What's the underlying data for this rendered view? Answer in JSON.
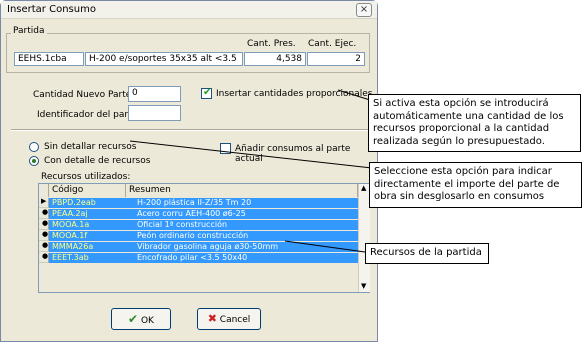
{
  "window": {
    "title": "Insertar Consumo",
    "close_glyph": "×"
  },
  "partida": {
    "group_label": "Partida",
    "col_pres": "Cant. Pres.",
    "col_ejec": "Cant. Ejec.",
    "code": "EEHS.1cba",
    "description": "H-200 e/soportes 35x35 alt <3.5",
    "cant_pres": "4,538",
    "cant_ejec": "2"
  },
  "form": {
    "cantidad_label": "Cantidad Nuevo Parte:",
    "cantidad_value": "0",
    "identificador_label": "Identificador del parte:",
    "identificador_value": "",
    "proporcionales_label": "Insertar cantidades proporcionales",
    "proporcionales_checked": true
  },
  "options": {
    "sin_detallar": "Sin detallar recursos",
    "con_detalle": "Con detalle de recursos",
    "selected": "con_detalle",
    "anadir_label": "Añadir consumos al parte actual",
    "anadir_checked": false
  },
  "recursos": {
    "label": "Recursos utilizados:",
    "col_codigo": "Código",
    "col_resumen": "Resumen",
    "rows": [
      {
        "code": "PBPD.2eab",
        "resumen": "H-200 plástica II-Z/35 Tm 20"
      },
      {
        "code": "PEAA.2aj",
        "resumen": "Acero corru AEH-400 ø6-25"
      },
      {
        "code": "MOOA.1a",
        "resumen": "Oficial 1ª construcción"
      },
      {
        "code": "MOOA.1f",
        "resumen": "Peón ordinario construcción"
      },
      {
        "code": "MMMA26a",
        "resumen": "Vibrador gasolina aguja ø30-50mm"
      },
      {
        "code": "EEET.3ab",
        "resumen": "Encofrado pilar <3.5 50x40"
      }
    ],
    "scroll_up": "▲",
    "scroll_down": "▼"
  },
  "buttons": {
    "ok": "OK",
    "cancel": "Cancel",
    "ok_icon": "✔",
    "cancel_icon": "✖",
    "ok_color": "#2e8b2e",
    "cancel_color": "#cc2020"
  },
  "callouts": {
    "proporcionales": "Si activa esta opción se introducirá automáticamente una cantidad de los recursos proporcional a la cantidad realizada según lo presupuestado.",
    "sin_detallar": "Seleccione esta opción para indicar directamente el importe del parte de obra sin desglosarlo en consumos",
    "recursos": "Recursos de la partida"
  },
  "colors": {
    "selection": "#3399ff",
    "code_text": "#ffff80",
    "window_bg": "#ece9d8"
  }
}
